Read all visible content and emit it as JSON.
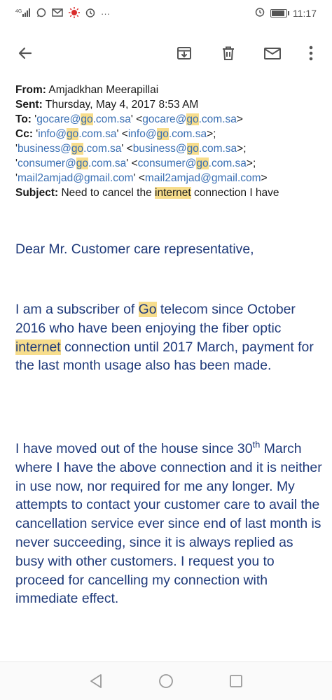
{
  "status_bar": {
    "time": "11:17",
    "icons": [
      "signal-icon",
      "whatsapp-icon",
      "mail-icon",
      "sun-icon",
      "alarm-icon",
      "more-icon",
      "alarm-icon",
      "battery-icon"
    ]
  },
  "toolbar": {
    "icons": [
      "back-arrow-icon",
      "archive-icon",
      "delete-icon",
      "mark-unread-icon",
      "more-vert-icon"
    ]
  },
  "email": {
    "from_label": "From:",
    "from_value": "Amjadkhan Meerapillai",
    "sent_label": "Sent:",
    "sent_value": "Thursday, May 4, 2017 8:53 AM",
    "to_label": "To:",
    "to_line": {
      "q1": "'",
      "a1a": "gocare@",
      "a1b": "go",
      "a1c": ".com.sa",
      "q2": "' <",
      "a2a": "gocare@",
      "a2b": "go",
      "a2c": ".com.sa",
      "end": ">"
    },
    "cc_label": "Cc:",
    "cc_line1": {
      "q1": "'",
      "a1a": "info@",
      "a1b": "go",
      "a1c": ".com.sa",
      "q2": "' <",
      "a2a": "info@",
      "a2b": "go",
      "a2c": ".com.sa",
      "end": ">;"
    },
    "cc_line2": {
      "q1": "'",
      "a1a": "business@",
      "a1b": "go",
      "a1c": ".com.sa",
      "q2": "' <",
      "a2a": "business@",
      "a2b": "go",
      "a2c": ".com.sa",
      "end": ">;"
    },
    "cc_line3": {
      "q1": "'",
      "a1a": "consumer@",
      "a1b": "go",
      "a1c": ".com.sa",
      "q2": "' <",
      "a2a": "consumer@",
      "a2b": "go",
      "a2c": ".com.sa",
      "end": ">;"
    },
    "cc_line4": {
      "q1": "'",
      "a1": "mail2amjad@gmail.com",
      "q2": "' <",
      "a2": "mail2amjad@gmail.com",
      "end": ">"
    },
    "subject_label": "Subject:",
    "subject_pre": "Need to cancel the ",
    "subject_hl": "internet",
    "subject_post": " connection I have",
    "greeting": "Dear Mr. Customer care representative,",
    "p1_a": "I am a subscriber of ",
    "p1_hl1": "Go",
    "p1_b": " telecom since October 2016 who have been enjoying the fiber optic ",
    "p1_hl2": "internet",
    "p1_c": " connection until 2017 March, payment for the last month usage also has been made.",
    "p2_a": "I have moved out of the house since 30",
    "p2_sup": "th",
    "p2_b": " March where I have the above connection and it is neither in use now, nor required for me any longer. My attempts to contact your customer care to avail the cancellation service ever since end of last month is never succeeding, since it is always replied as busy with other customers. I request you to proceed for cancelling my connection with immediate effect."
  },
  "nav_bar": {
    "icons": [
      "back-triangle-icon",
      "home-circle-icon",
      "recents-square-icon"
    ]
  }
}
